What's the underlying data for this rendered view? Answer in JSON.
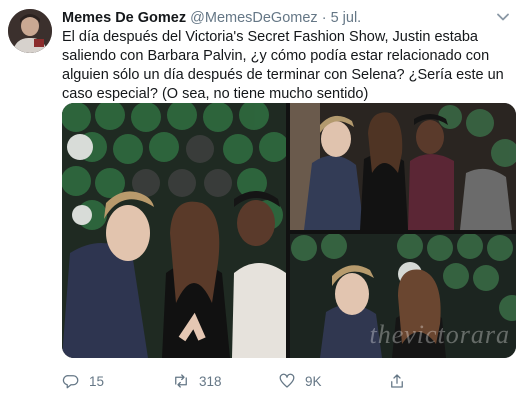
{
  "tweet": {
    "author_name": "Memes De Gomez",
    "author_handle": "@MemesDeGomez",
    "separator": "·",
    "date": "5 jul.",
    "text": "El día después del Victoria's Secret Fashion Show, Justin estaba saliendo con Barbara Palvin, ¿y cómo podía estar relacionado con alguien sólo un día después de terminar con Selena? ¿Sería este un caso especial? (O sea, no tiene mucho sentido)"
  },
  "media": {
    "watermark": "thevictorara",
    "photo_count": 3
  },
  "actions": {
    "reply_count": "15",
    "retweet_count": "318",
    "like_count": "9K"
  },
  "icons": {
    "menu": "chevron-down-icon",
    "reply": "reply-icon",
    "retweet": "retweet-icon",
    "like": "heart-icon",
    "share": "share-icon"
  },
  "colors": {
    "text": "#14171a",
    "secondary": "#657786",
    "background": "#ffffff"
  }
}
